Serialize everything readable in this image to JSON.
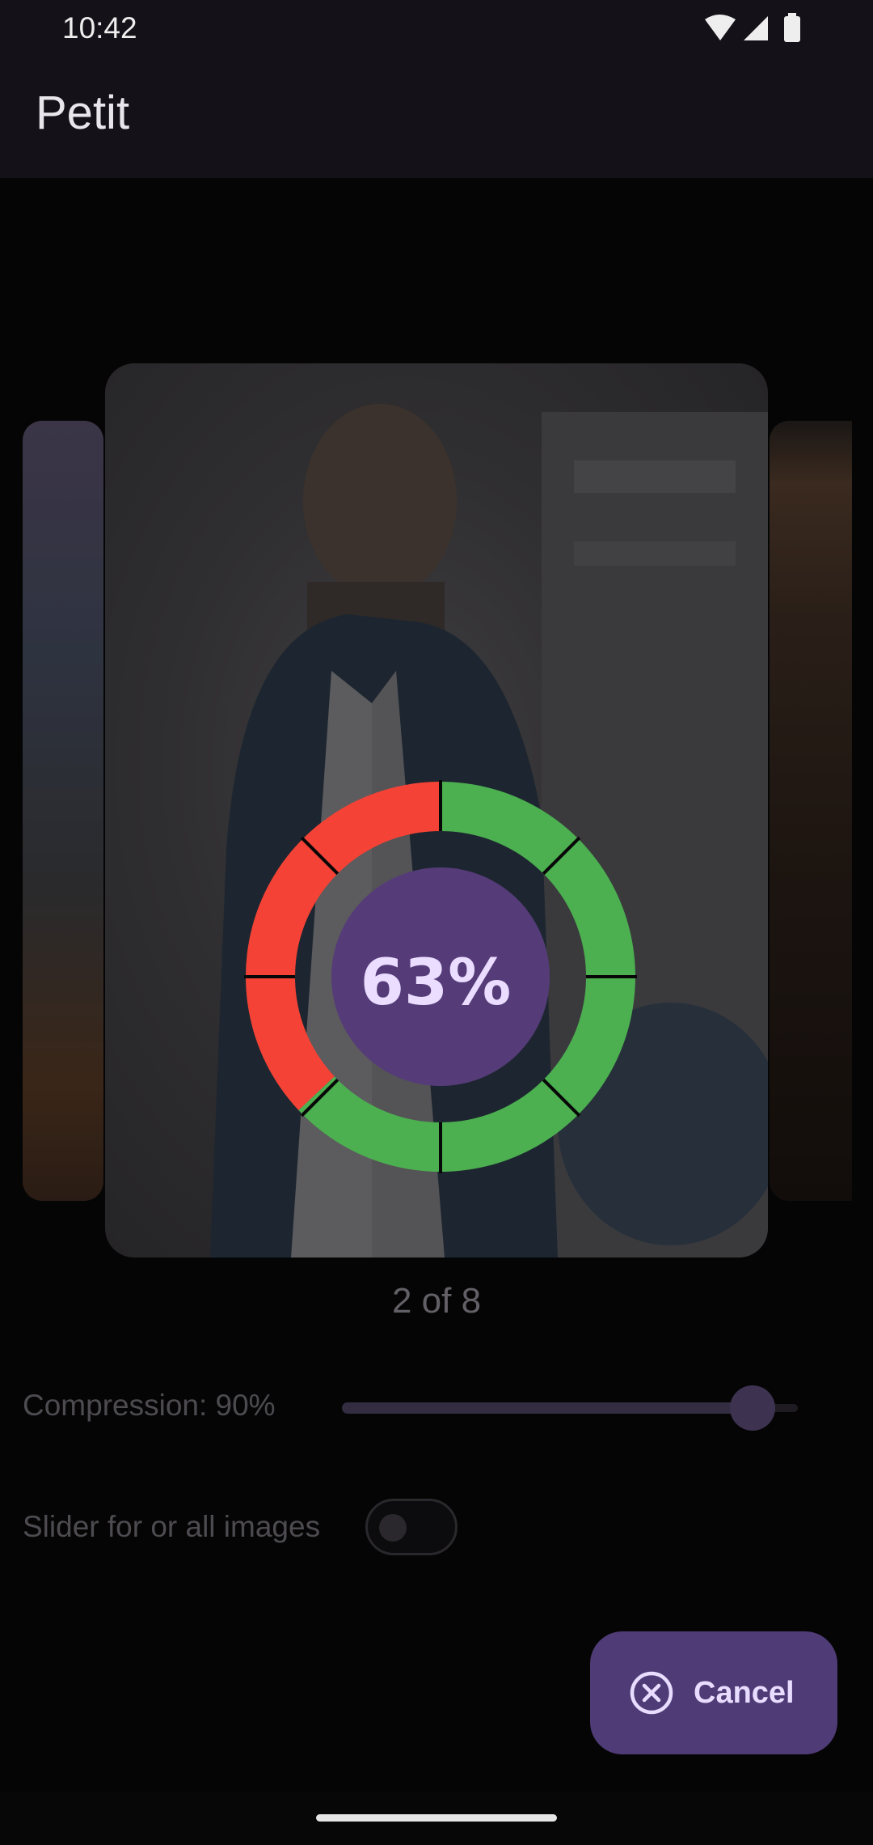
{
  "status_bar": {
    "time": "10:42",
    "icons": [
      "wifi-icon",
      "cellular-signal-icon",
      "battery-icon"
    ]
  },
  "app_bar": {
    "title": "Petit"
  },
  "carousel": {
    "page_indicator": "2 of 8",
    "progress": {
      "label": "63%",
      "fraction": 0.63,
      "segments": 8,
      "filled_color": "#4caf50",
      "remaining_color": "#f44336",
      "center_color": "#553c79"
    }
  },
  "compression": {
    "label": "Compression: 90%",
    "value": 0.9
  },
  "toggle": {
    "label": "Slider for or all images",
    "checked": false
  },
  "fab": {
    "label": "Cancel",
    "icon": "cancel-circle-icon",
    "color": "#4f3b76"
  }
}
